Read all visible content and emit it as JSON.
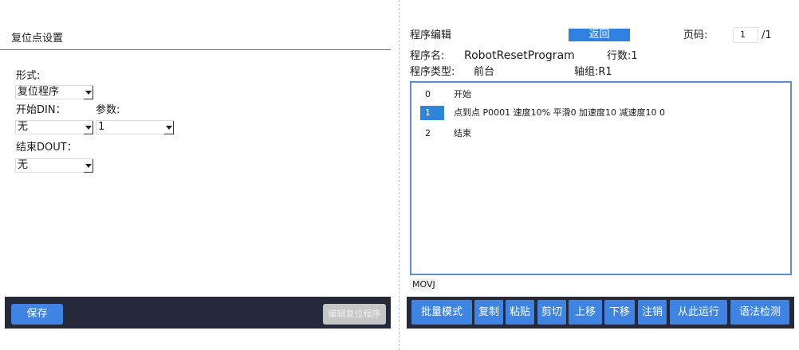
{
  "left": {
    "title": "复位点设置",
    "form_label": "形式:",
    "form_value": "复位程序",
    "start_din_label": "开始DIN：",
    "param_label": "参数:",
    "start_din_value": "无",
    "param_value": "1",
    "end_dout_label": "结束DOUT：",
    "end_dout_value": "无",
    "save_label": "保存",
    "edit_reset_label": "编辑复位程序"
  },
  "right": {
    "title": "程序编辑",
    "return_label": "返回",
    "page_label": "页码:",
    "page_value": "1",
    "page_total": "/1",
    "program_name_label": "程序名:",
    "program_name": "RobotResetProgram",
    "lines_label": "行数:1",
    "program_type_label": "程序类型:",
    "program_type": "前台",
    "axis_group": "轴组:R1",
    "lines": [
      {
        "num": "0",
        "code": "开始",
        "selected": false
      },
      {
        "num": "1",
        "code": "点到点 P0001 速度10% 平滑0 加速度10 减速度10 0",
        "selected": true
      },
      {
        "num": "2",
        "code": "结束",
        "selected": false
      }
    ],
    "status_tag": "MOVJ",
    "toolbar": {
      "batch": "批量模式",
      "copy": "复制",
      "paste": "粘贴",
      "cut": "剪切",
      "move_up": "上移",
      "move_down": "下移",
      "comment": "注销",
      "run_from_here": "从此运行",
      "syntax_check": "语法检测"
    }
  },
  "colors": {
    "accent": "#3f84e3",
    "footer": "#25293a",
    "editor_border": "#5a8fd6",
    "selected_line": "#2d86d9"
  }
}
